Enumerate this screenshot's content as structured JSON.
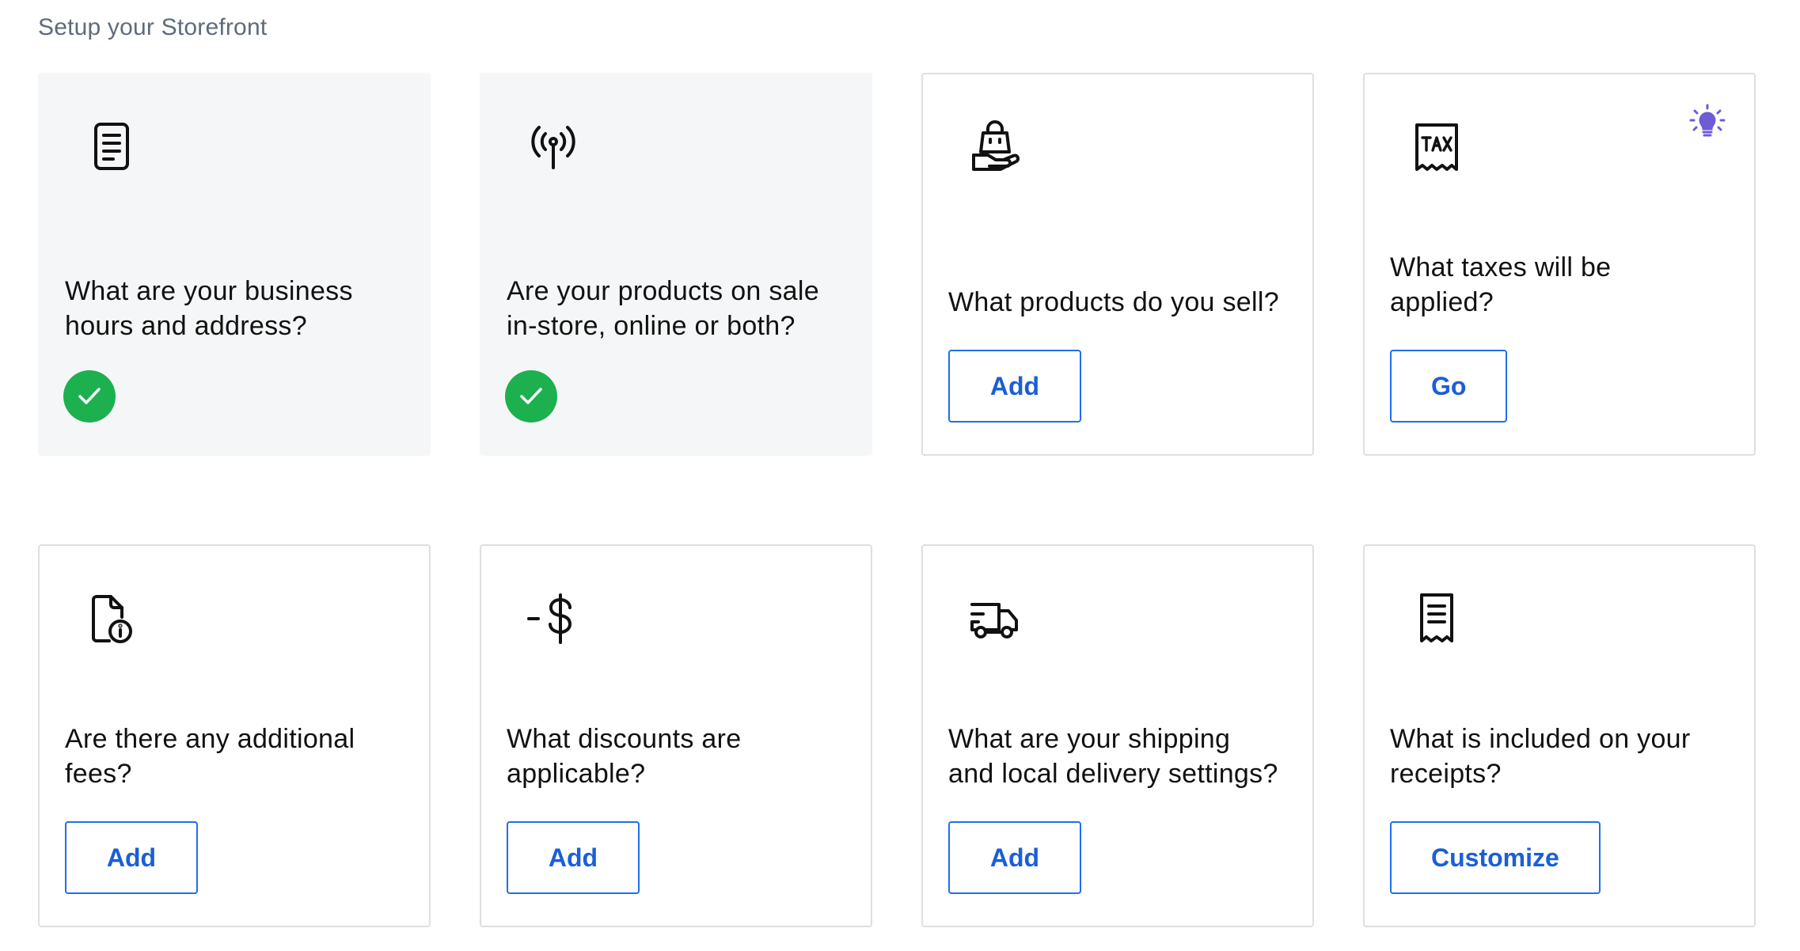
{
  "section_title": "Setup your Storefront",
  "cards": [
    {
      "icon": "document-icon",
      "question": "What are your business hours and address?",
      "status": "complete"
    },
    {
      "icon": "broadcast-antenna-icon",
      "question": "Are your products on sale in-store, online or both?",
      "status": "complete"
    },
    {
      "icon": "shopping-bag-hand-icon",
      "question": "What products do you sell?",
      "button": "Add"
    },
    {
      "icon": "tax-receipt-icon",
      "question": "What taxes will be applied?",
      "button": "Go",
      "tip_icon": "lightbulb-icon"
    },
    {
      "icon": "document-info-icon",
      "question": "Are there any additional fees?",
      "button": "Add"
    },
    {
      "icon": "minus-dollar-icon",
      "question": "What discounts are applicable?",
      "button": "Add"
    },
    {
      "icon": "delivery-truck-icon",
      "question": "What are your shipping and local delivery settings?",
      "button": "Add"
    },
    {
      "icon": "receipt-icon",
      "question": "What is included on your receipts?",
      "button": "Customize"
    }
  ],
  "colors": {
    "check": "#1db04f",
    "button_text": "#1a5fd6",
    "button_border": "#1f6feb",
    "tip": "#6e5bd6"
  }
}
